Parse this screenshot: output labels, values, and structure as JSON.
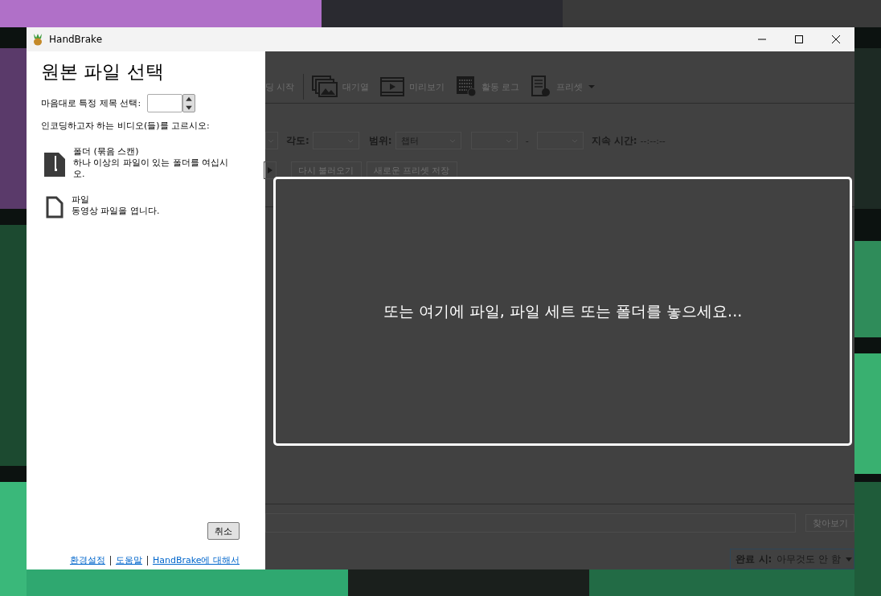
{
  "window": {
    "title": "HandBrake"
  },
  "source_panel": {
    "title": "원본 파일 선택",
    "title_select_label": "마음대로 특정 제목 선택:",
    "prompt": "인코딩하고자 하는 비디오(들)를 고르시오:",
    "options": [
      {
        "kind": "folder",
        "title": "폴더 (묶음 스캔)",
        "description": "하나 이상의 파일이 있는 폴더를 여십시오."
      },
      {
        "kind": "file",
        "title": "파일",
        "description": "동영상 파일을 엽니다."
      }
    ],
    "cancel_button": "취소",
    "links": [
      "환경설정",
      "도움말",
      "HandBrake에 대해서"
    ]
  },
  "toolbar": [
    {
      "kind": "start",
      "label": "딩 시작"
    },
    {
      "kind": "queue",
      "label": "대기열"
    },
    {
      "kind": "preview",
      "label": "미리보기"
    },
    {
      "kind": "log",
      "label": "활동 로그"
    },
    {
      "kind": "presets",
      "label": "프리셋"
    }
  ],
  "source_row": {
    "angle_label": "각도:",
    "range_label": "범위:",
    "range_value": "챕터",
    "separator": "-",
    "duration_label": "지속 시간:",
    "duration_value": "--:--:--"
  },
  "preset_row": {
    "buttons": [
      "다시 불러오기",
      "새로운 프리셋 저장"
    ]
  },
  "drop_zone": {
    "text": "또는 여기에 파일, 파일 세트 또는 폴더를 놓으세요..."
  },
  "destination": {
    "browse_button": "찾아보기"
  },
  "status_bar": {
    "when_done_label": "완료 시:",
    "when_done_value": "아무것도 안 함"
  }
}
